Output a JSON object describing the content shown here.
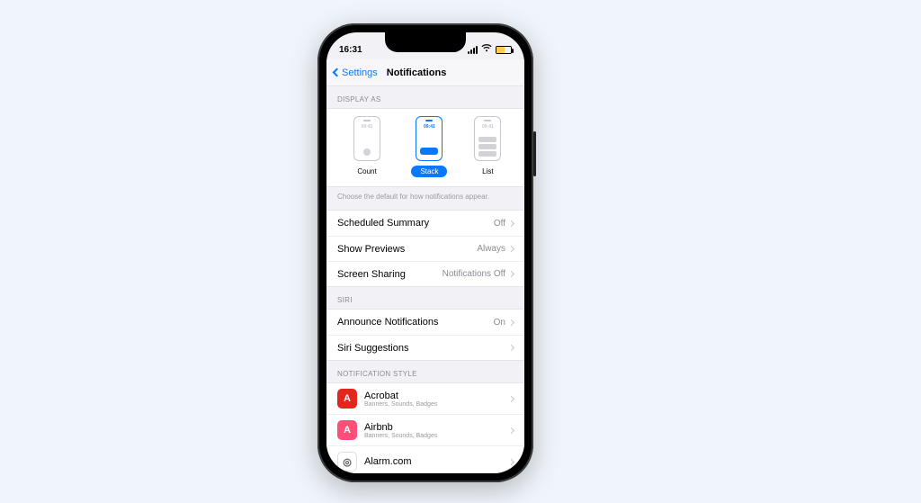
{
  "statusbar": {
    "time": "16:31"
  },
  "nav": {
    "back": "Settings",
    "title": "Notifications"
  },
  "display_as": {
    "header": "DISPLAY AS",
    "thumb_time": "09:41",
    "options": [
      {
        "label": "Count",
        "selected": false
      },
      {
        "label": "Stack",
        "selected": true
      },
      {
        "label": "List",
        "selected": false
      }
    ],
    "caption": "Choose the default for how notifications appear."
  },
  "settings": [
    {
      "label": "Scheduled Summary",
      "value": "Off"
    },
    {
      "label": "Show Previews",
      "value": "Always"
    },
    {
      "label": "Screen Sharing",
      "value": "Notifications Off"
    }
  ],
  "siri": {
    "header": "SIRI",
    "rows": [
      {
        "label": "Announce Notifications",
        "value": "On"
      },
      {
        "label": "Siri Suggestions",
        "value": ""
      }
    ]
  },
  "notif_style": {
    "header": "NOTIFICATION STYLE",
    "apps": [
      {
        "name": "Acrobat",
        "sub": "Banners, Sounds, Badges",
        "icon_bg": "#e2261e",
        "icon_glyph": "A"
      },
      {
        "name": "Airbnb",
        "sub": "Banners, Sounds, Badges",
        "icon_bg": "#ff4f78",
        "icon_glyph": "A"
      },
      {
        "name": "Alarm.com",
        "sub": "",
        "icon_bg": "#ffffff",
        "icon_glyph": "◎"
      }
    ]
  }
}
